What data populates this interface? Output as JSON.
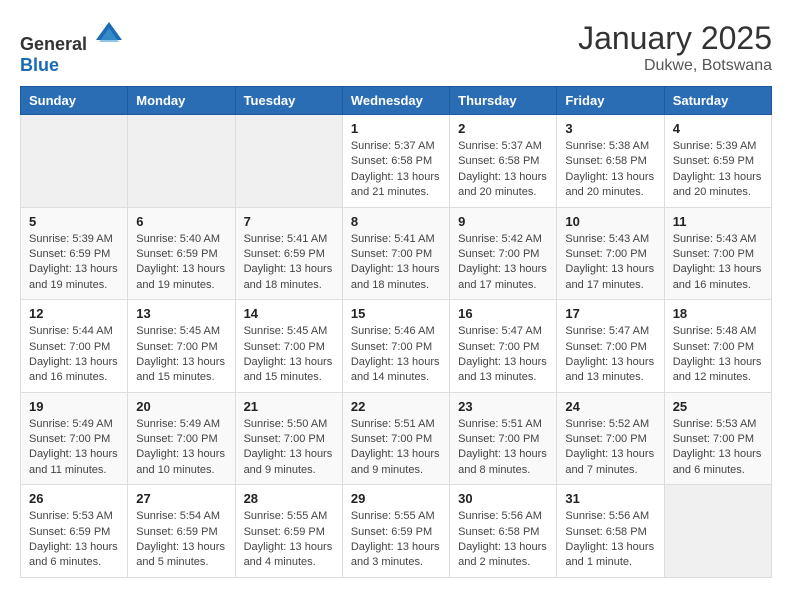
{
  "header": {
    "logo_general": "General",
    "logo_blue": "Blue",
    "month": "January 2025",
    "location": "Dukwe, Botswana"
  },
  "weekdays": [
    "Sunday",
    "Monday",
    "Tuesday",
    "Wednesday",
    "Thursday",
    "Friday",
    "Saturday"
  ],
  "weeks": [
    [
      {
        "day": "",
        "info": ""
      },
      {
        "day": "",
        "info": ""
      },
      {
        "day": "",
        "info": ""
      },
      {
        "day": "1",
        "info": "Sunrise: 5:37 AM\nSunset: 6:58 PM\nDaylight: 13 hours and 21 minutes."
      },
      {
        "day": "2",
        "info": "Sunrise: 5:37 AM\nSunset: 6:58 PM\nDaylight: 13 hours and 20 minutes."
      },
      {
        "day": "3",
        "info": "Sunrise: 5:38 AM\nSunset: 6:58 PM\nDaylight: 13 hours and 20 minutes."
      },
      {
        "day": "4",
        "info": "Sunrise: 5:39 AM\nSunset: 6:59 PM\nDaylight: 13 hours and 20 minutes."
      }
    ],
    [
      {
        "day": "5",
        "info": "Sunrise: 5:39 AM\nSunset: 6:59 PM\nDaylight: 13 hours and 19 minutes."
      },
      {
        "day": "6",
        "info": "Sunrise: 5:40 AM\nSunset: 6:59 PM\nDaylight: 13 hours and 19 minutes."
      },
      {
        "day": "7",
        "info": "Sunrise: 5:41 AM\nSunset: 6:59 PM\nDaylight: 13 hours and 18 minutes."
      },
      {
        "day": "8",
        "info": "Sunrise: 5:41 AM\nSunset: 7:00 PM\nDaylight: 13 hours and 18 minutes."
      },
      {
        "day": "9",
        "info": "Sunrise: 5:42 AM\nSunset: 7:00 PM\nDaylight: 13 hours and 17 minutes."
      },
      {
        "day": "10",
        "info": "Sunrise: 5:43 AM\nSunset: 7:00 PM\nDaylight: 13 hours and 17 minutes."
      },
      {
        "day": "11",
        "info": "Sunrise: 5:43 AM\nSunset: 7:00 PM\nDaylight: 13 hours and 16 minutes."
      }
    ],
    [
      {
        "day": "12",
        "info": "Sunrise: 5:44 AM\nSunset: 7:00 PM\nDaylight: 13 hours and 16 minutes."
      },
      {
        "day": "13",
        "info": "Sunrise: 5:45 AM\nSunset: 7:00 PM\nDaylight: 13 hours and 15 minutes."
      },
      {
        "day": "14",
        "info": "Sunrise: 5:45 AM\nSunset: 7:00 PM\nDaylight: 13 hours and 15 minutes."
      },
      {
        "day": "15",
        "info": "Sunrise: 5:46 AM\nSunset: 7:00 PM\nDaylight: 13 hours and 14 minutes."
      },
      {
        "day": "16",
        "info": "Sunrise: 5:47 AM\nSunset: 7:00 PM\nDaylight: 13 hours and 13 minutes."
      },
      {
        "day": "17",
        "info": "Sunrise: 5:47 AM\nSunset: 7:00 PM\nDaylight: 13 hours and 13 minutes."
      },
      {
        "day": "18",
        "info": "Sunrise: 5:48 AM\nSunset: 7:00 PM\nDaylight: 13 hours and 12 minutes."
      }
    ],
    [
      {
        "day": "19",
        "info": "Sunrise: 5:49 AM\nSunset: 7:00 PM\nDaylight: 13 hours and 11 minutes."
      },
      {
        "day": "20",
        "info": "Sunrise: 5:49 AM\nSunset: 7:00 PM\nDaylight: 13 hours and 10 minutes."
      },
      {
        "day": "21",
        "info": "Sunrise: 5:50 AM\nSunset: 7:00 PM\nDaylight: 13 hours and 9 minutes."
      },
      {
        "day": "22",
        "info": "Sunrise: 5:51 AM\nSunset: 7:00 PM\nDaylight: 13 hours and 9 minutes."
      },
      {
        "day": "23",
        "info": "Sunrise: 5:51 AM\nSunset: 7:00 PM\nDaylight: 13 hours and 8 minutes."
      },
      {
        "day": "24",
        "info": "Sunrise: 5:52 AM\nSunset: 7:00 PM\nDaylight: 13 hours and 7 minutes."
      },
      {
        "day": "25",
        "info": "Sunrise: 5:53 AM\nSunset: 7:00 PM\nDaylight: 13 hours and 6 minutes."
      }
    ],
    [
      {
        "day": "26",
        "info": "Sunrise: 5:53 AM\nSunset: 6:59 PM\nDaylight: 13 hours and 6 minutes."
      },
      {
        "day": "27",
        "info": "Sunrise: 5:54 AM\nSunset: 6:59 PM\nDaylight: 13 hours and 5 minutes."
      },
      {
        "day": "28",
        "info": "Sunrise: 5:55 AM\nSunset: 6:59 PM\nDaylight: 13 hours and 4 minutes."
      },
      {
        "day": "29",
        "info": "Sunrise: 5:55 AM\nSunset: 6:59 PM\nDaylight: 13 hours and 3 minutes."
      },
      {
        "day": "30",
        "info": "Sunrise: 5:56 AM\nSunset: 6:58 PM\nDaylight: 13 hours and 2 minutes."
      },
      {
        "day": "31",
        "info": "Sunrise: 5:56 AM\nSunset: 6:58 PM\nDaylight: 13 hours and 1 minute."
      },
      {
        "day": "",
        "info": ""
      }
    ]
  ]
}
